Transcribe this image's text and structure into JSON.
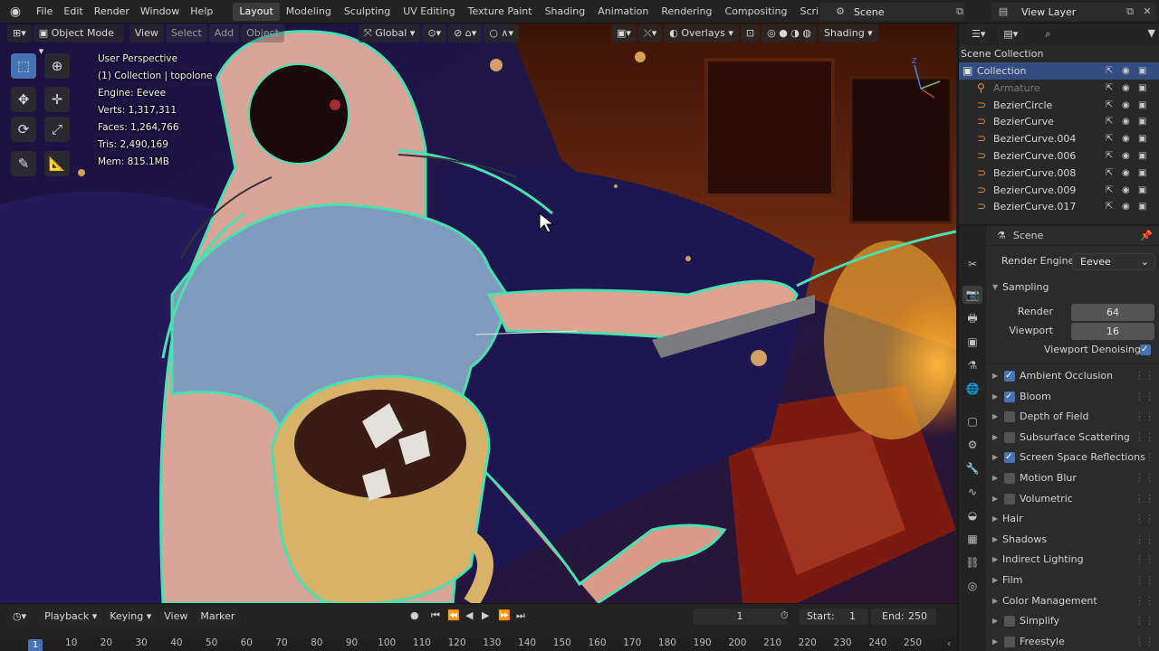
{
  "topbar": {
    "menus": [
      "File",
      "Edit",
      "Render",
      "Window",
      "Help"
    ],
    "workspaces": [
      "Layout",
      "Modeling",
      "Sculpting",
      "UV Editing",
      "Texture Paint",
      "Shading",
      "Animation",
      "Rendering",
      "Compositing",
      "Scripting"
    ],
    "active_workspace": "Layout",
    "scene": "Scene",
    "view_layer": "View Layer"
  },
  "viewport": {
    "mode": "Object Mode",
    "menus": [
      "View",
      "Select",
      "Add",
      "Object"
    ],
    "transform_orientation": "Global",
    "overlays_label": "Overlays",
    "shading_label": "Shading",
    "info": {
      "line1": "User Perspective",
      "line2": "(1) Collection | topolone",
      "line3": "Engine: Eevee",
      "line4": "Verts: 1,317,311",
      "line5": "Faces: 1,264,766",
      "line6": "Tris: 2,490,169",
      "line7": "Mem: 815.1MB"
    },
    "gizmo_axes": {
      "x": "X",
      "y": "Y",
      "z": "Z"
    }
  },
  "timeline": {
    "menus": [
      "Playback",
      "Keying",
      "View",
      "Marker"
    ],
    "current_frame": "1",
    "start_label": "Start:",
    "start": "1",
    "end_label": "End:",
    "end": "250",
    "ticks": [
      "1",
      "10",
      "20",
      "30",
      "40",
      "50",
      "60",
      "70",
      "80",
      "90",
      "100",
      "110",
      "120",
      "130",
      "140",
      "150",
      "160",
      "170",
      "180",
      "190",
      "200",
      "210",
      "220",
      "230",
      "240",
      "250"
    ]
  },
  "outliner": {
    "header": "Scene Collection",
    "items": [
      {
        "name": "Collection",
        "icon": "collection-icon"
      },
      {
        "name": "Armature",
        "icon": "armature-icon"
      },
      {
        "name": "BezierCircle",
        "icon": "curve-icon"
      },
      {
        "name": "BezierCurve",
        "icon": "curve-icon"
      },
      {
        "name": "BezierCurve.004",
        "icon": "curve-icon"
      },
      {
        "name": "BezierCurve.006",
        "icon": "curve-icon"
      },
      {
        "name": "BezierCurve.008",
        "icon": "curve-icon"
      },
      {
        "name": "BezierCurve.009",
        "icon": "curve-icon"
      },
      {
        "name": "BezierCurve.017",
        "icon": "curve-icon"
      }
    ]
  },
  "properties": {
    "context": "Scene",
    "render_engine_label": "Render Engine",
    "render_engine": "Eevee",
    "sampling": {
      "title": "Sampling",
      "render_label": "Render",
      "render": "64",
      "viewport_label": "Viewport",
      "viewport": "16",
      "denoise_label": "Viewport Denoising"
    },
    "panels": [
      {
        "label": "Ambient Occlusion",
        "checkbox": true,
        "checked": true
      },
      {
        "label": "Bloom",
        "checkbox": true,
        "checked": true
      },
      {
        "label": "Depth of Field",
        "checkbox": true,
        "checked": false
      },
      {
        "label": "Subsurface Scattering",
        "checkbox": true,
        "checked": false
      },
      {
        "label": "Screen Space Reflections",
        "checkbox": true,
        "checked": true
      },
      {
        "label": "Motion Blur",
        "checkbox": true,
        "checked": false
      },
      {
        "label": "Volumetric",
        "checkbox": true,
        "checked": false
      },
      {
        "label": "Hair",
        "checkbox": false,
        "checked": false
      },
      {
        "label": "Shadows",
        "checkbox": false,
        "checked": false
      },
      {
        "label": "Indirect Lighting",
        "checkbox": false,
        "checked": false
      },
      {
        "label": "Film",
        "checkbox": false,
        "checked": false
      },
      {
        "label": "Color Management",
        "checkbox": false,
        "checked": false
      },
      {
        "label": "Simplify",
        "checkbox": true,
        "checked": false
      },
      {
        "label": "Freestyle",
        "checkbox": true,
        "checked": false
      }
    ]
  },
  "colors": {
    "accent": "#4772b3",
    "outline_selection": "#4be0b0",
    "curve_object": "#e8913a"
  }
}
